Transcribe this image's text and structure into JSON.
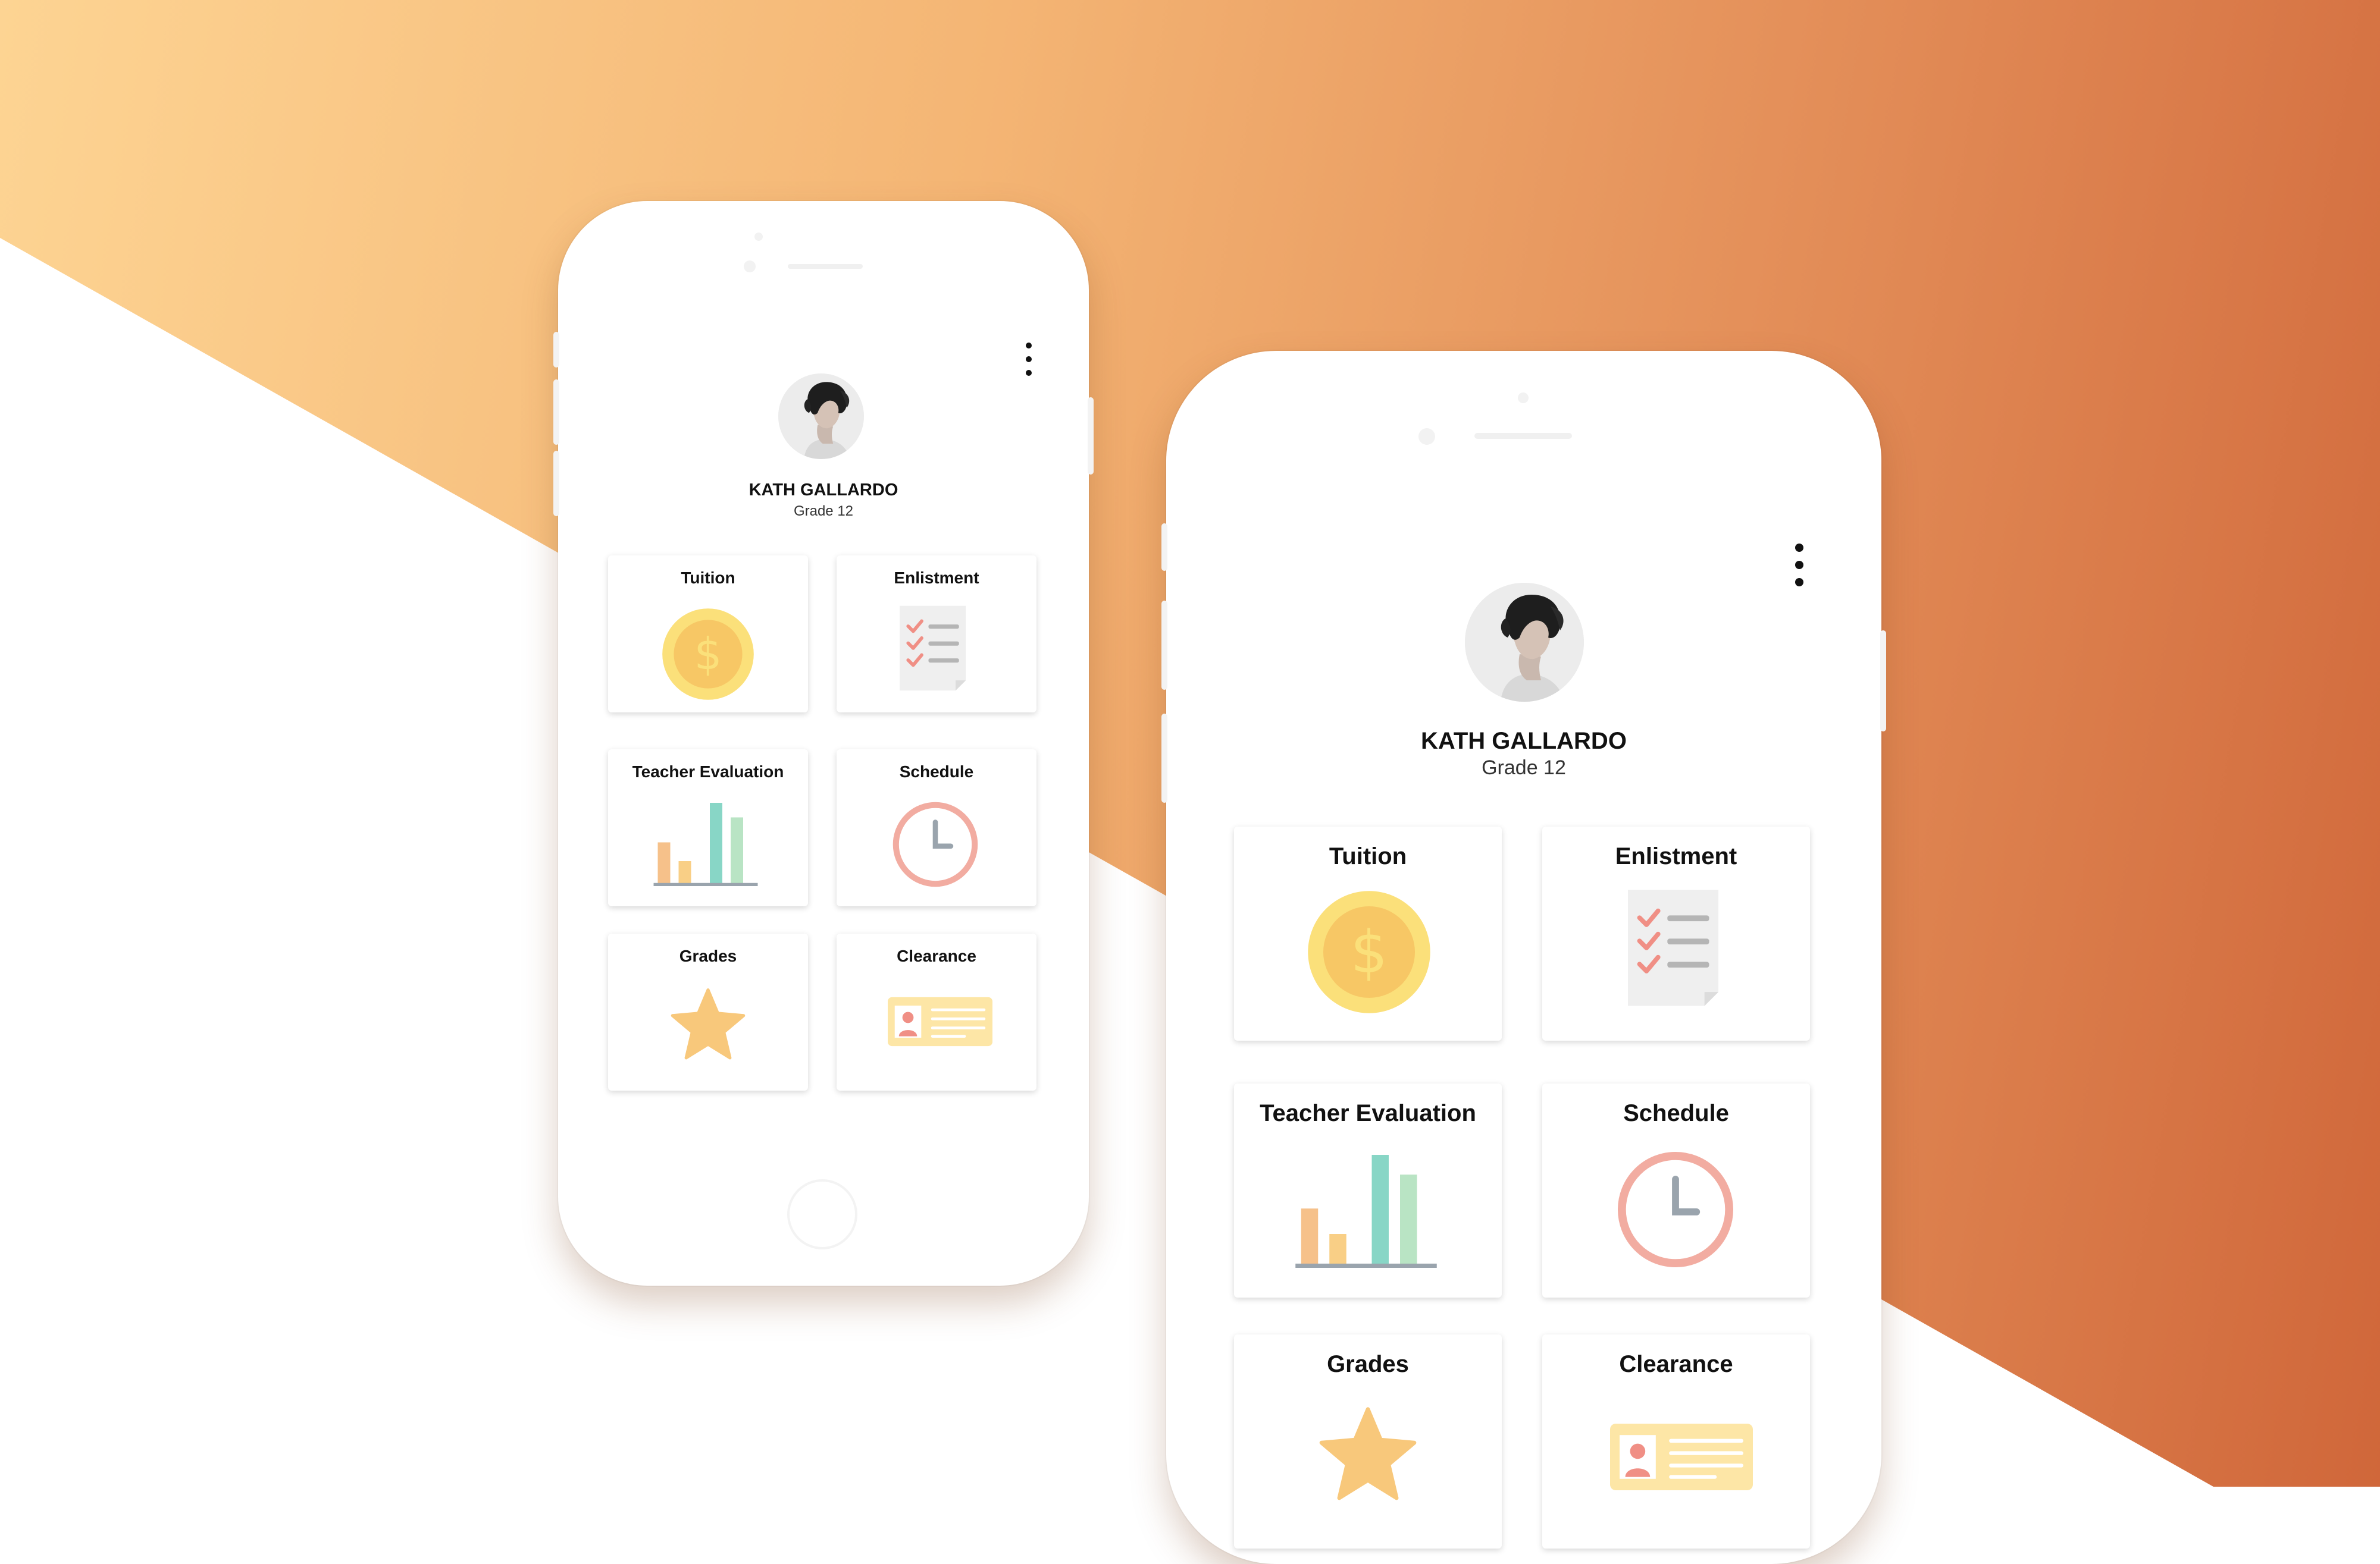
{
  "profile": {
    "name": "KATH GALLARDO",
    "grade": "Grade 12"
  },
  "menu": {
    "icon": "more-vertical-icon"
  },
  "cards": [
    {
      "label": "Tuition",
      "icon": "dollar-coin-icon"
    },
    {
      "label": "Enlistment",
      "icon": "checklist-icon"
    },
    {
      "label": "Teacher Evaluation",
      "icon": "bar-chart-icon"
    },
    {
      "label": "Schedule",
      "icon": "clock-icon"
    },
    {
      "label": "Grades",
      "icon": "star-icon"
    },
    {
      "label": "Clearance",
      "icon": "id-card-icon"
    }
  ],
  "colors": {
    "background_gradient": [
      "#fdd493",
      "#f4b574",
      "#e4905a",
      "#d0673a"
    ],
    "coin": "#fbe07a",
    "coin_inner": "#f7c765",
    "check": "#f08f85",
    "bar_orange": "#f6c18a",
    "bar_teal": "#88d6c6",
    "bar_green": "#b9e4c4",
    "clock_ring": "#f2aca1",
    "star": "#f8c87b",
    "card_yellow": "#fde6a6"
  }
}
